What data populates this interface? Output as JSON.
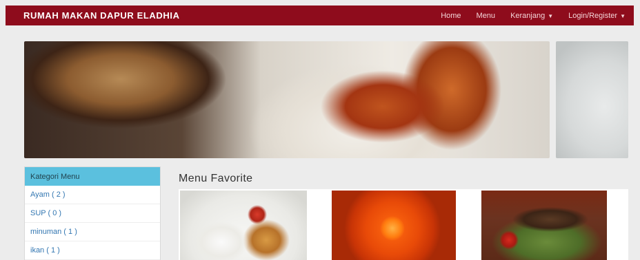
{
  "navbar": {
    "brand": "RUMAH MAKAN DAPUR ELADHIA",
    "items": [
      {
        "label": "Home"
      },
      {
        "label": "Menu"
      },
      {
        "label": "Keranjang"
      },
      {
        "label": "Login/Register"
      }
    ],
    "color": "#8e0c1c"
  },
  "carousel": {
    "indicators": 2,
    "active_index": 1
  },
  "sidebar": {
    "header": "Kategori Menu",
    "items": [
      {
        "label": "Ayam ( 2 )"
      },
      {
        "label": "SUP ( 0 )"
      },
      {
        "label": "minuman ( 1 )"
      },
      {
        "label": "ikan ( 1 )"
      }
    ],
    "header_color": "#5bc0de"
  },
  "main": {
    "title": "Menu Favorite"
  }
}
